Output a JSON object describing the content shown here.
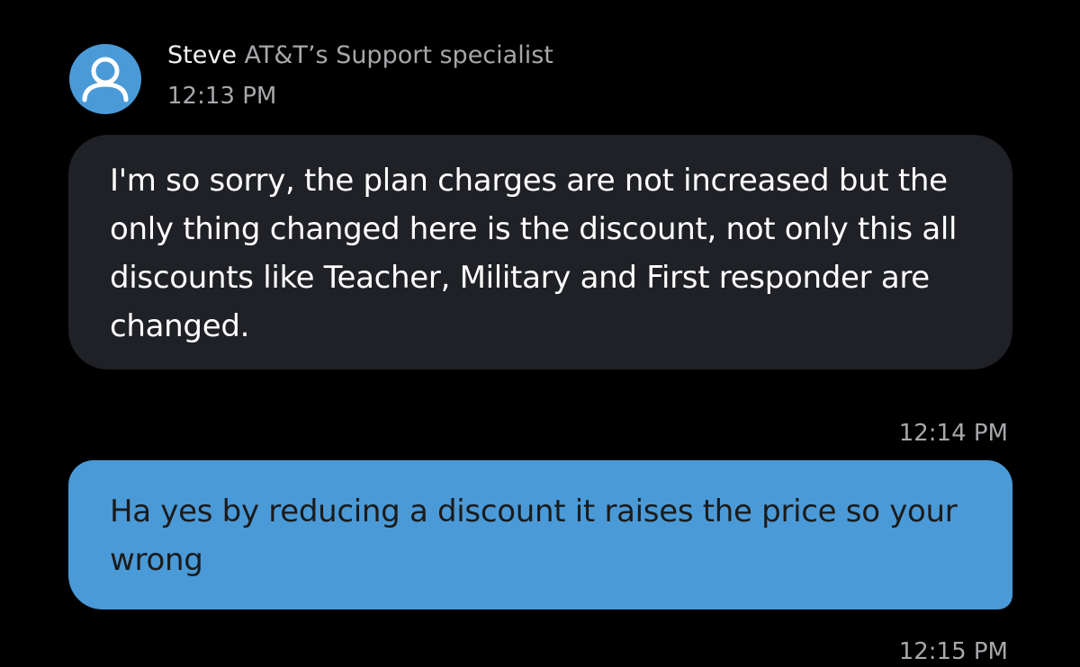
{
  "header": {
    "sender_name": "Steve",
    "sender_role": "AT&T’s Support specialist",
    "time": "12:13 PM",
    "avatar_icon": "person-icon"
  },
  "messages": [
    {
      "direction": "incoming",
      "text": "I'm so sorry, the plan charges are not increased but the only thing changed here is the discount, not only this all discounts like Teacher, Military and First responder are changed."
    },
    {
      "direction": "outgoing",
      "time": "12:14 PM",
      "text": "Ha yes by reducing a discount it raises the price so your wrong"
    }
  ],
  "footer": {
    "time": "12:15 PM"
  },
  "colors": {
    "background": "#000000",
    "incoming_bubble": "#1f2126",
    "outgoing_bubble": "#4a9ad8",
    "avatar": "#4a9ad8",
    "secondary_text": "#a6a8ab"
  }
}
